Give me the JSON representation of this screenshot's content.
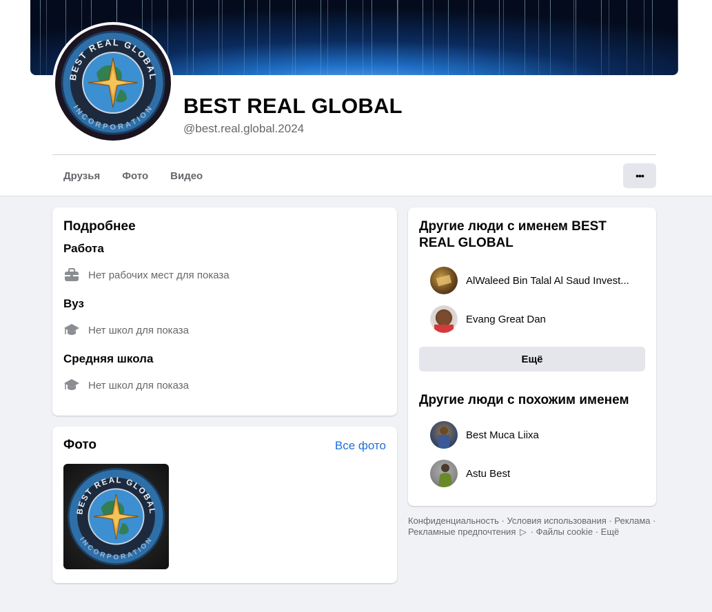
{
  "profile": {
    "name": "BEST REAL GLOBAL",
    "handle": "@best.real.global.2024"
  },
  "tabs": [
    {
      "label": "Друзья"
    },
    {
      "label": "Фото"
    },
    {
      "label": "Видео"
    }
  ],
  "more_button": "•••",
  "about": {
    "title": "Подробнее",
    "work_title": "Работа",
    "work_text": "Нет рабочих мест для показа",
    "university_title": "Вуз",
    "university_text": "Нет школ для показа",
    "highschool_title": "Средняя школа",
    "highschool_text": "Нет школ для показа"
  },
  "photos": {
    "title": "Фото",
    "all_link": "Все фото"
  },
  "same_name": {
    "title": "Другие люди с именем BEST REAL GLOBAL",
    "people": [
      {
        "name": "AlWaleed Bin Talal Al Saud Invest..."
      },
      {
        "name": "Evang Great Dan"
      }
    ],
    "more_button": "Ещё"
  },
  "similar_name": {
    "title": "Другие люди с похожим именем",
    "people": [
      {
        "name": "Best Muca Liixa"
      },
      {
        "name": "Astu Best"
      }
    ]
  },
  "footer": {
    "privacy": "Конфиденциальность",
    "terms": "Условия использования",
    "ads": "Реклама",
    "ad_choices": "Рекламные предпочтения",
    "cookies": "Файлы cookie",
    "more": "Ещё",
    "sep": "·"
  },
  "logo_text": {
    "top": "BEST REAL GLOBAL",
    "bottom": "INCORPORATION"
  },
  "colors": {
    "accent": "#216fdb",
    "page_bg": "#f0f2f5",
    "secondary_text": "#65676b",
    "button_bg": "#e4e6eb"
  }
}
